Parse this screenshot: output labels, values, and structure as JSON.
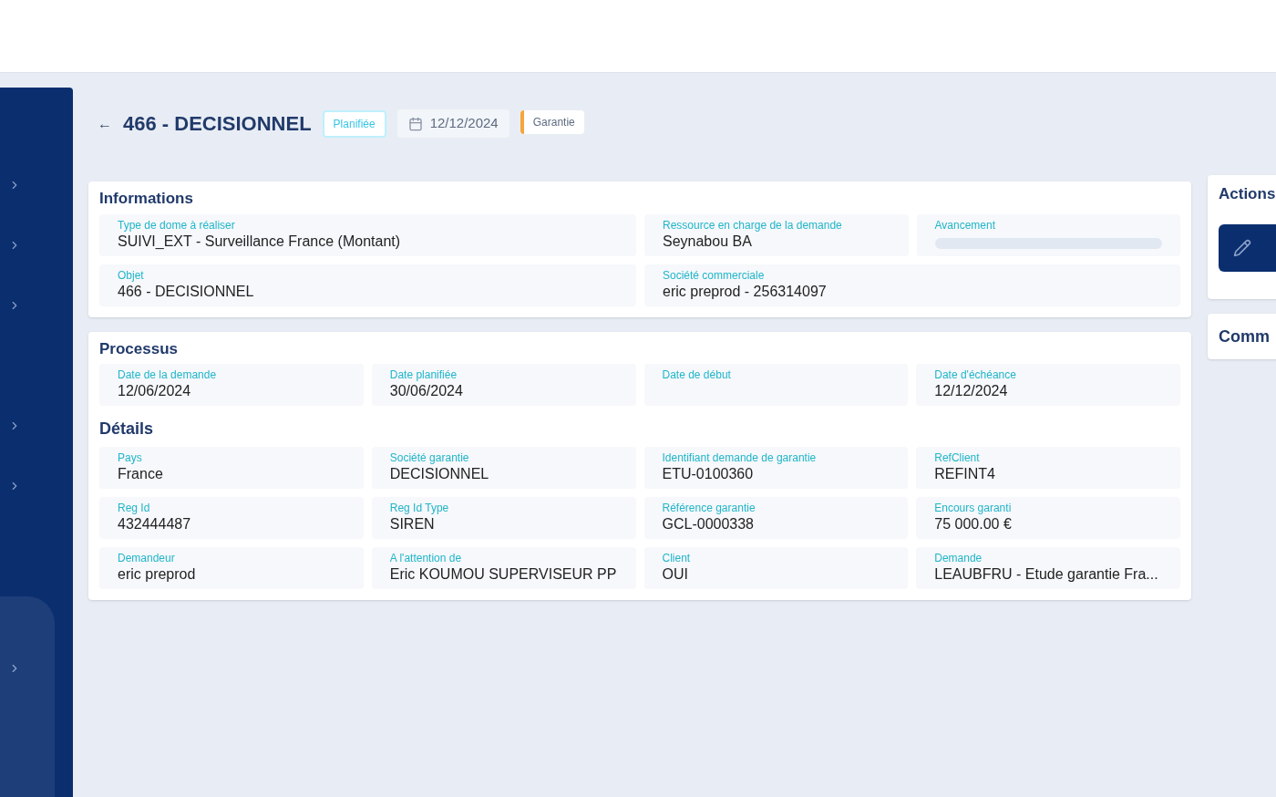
{
  "sidebar": {
    "items": [
      {
        "kind": "chevron"
      },
      {
        "kind": "chevron"
      },
      {
        "kind": "chevron"
      },
      {
        "kind": "chevron"
      },
      {
        "kind": "chevron"
      },
      {
        "kind": "chevron"
      }
    ]
  },
  "header": {
    "back": "←",
    "title": "466 - DECISIONNEL",
    "status": "Planifiée",
    "date": "12/12/2024",
    "tag": "Garantie"
  },
  "informations": {
    "title": "Informations",
    "rows": [
      [
        {
          "label": "Type de dome à réaliser",
          "value": "SUIVI_EXT - Surveillance France (Montant)",
          "kind": "text"
        },
        {
          "label": "Ressource en charge de la demande",
          "value": "Seynabou BA",
          "kind": "text"
        },
        {
          "label": "Avancement",
          "kind": "skeleton"
        }
      ],
      [
        {
          "label": "Objet",
          "value": "466 - DECISIONNEL",
          "kind": "text"
        },
        {
          "label": "Société commerciale",
          "value": "eric preprod - 256314097",
          "kind": "text"
        }
      ]
    ]
  },
  "processus": {
    "title": "Processus",
    "fields": [
      {
        "label": "Date de la demande",
        "value": "12/06/2024"
      },
      {
        "label": "Date planifiée",
        "value": "30/06/2024"
      },
      {
        "label": "Date de début"
      },
      {
        "label": "Date d'échéance",
        "value": "12/12/2024"
      }
    ]
  },
  "details": {
    "title": "Détails",
    "fields": [
      {
        "label": "Pays",
        "value": "France"
      },
      {
        "label": "Société garantie",
        "value": "DECISIONNEL"
      },
      {
        "label": "Identifiant demande de garantie",
        "value": "ETU-0100360"
      },
      {
        "label": "RefClient",
        "value": "REFINT4"
      },
      {
        "label": "Reg Id",
        "value": "432444487"
      },
      {
        "label": "Reg Id Type",
        "value": "SIREN"
      },
      {
        "label": "Référence garantie",
        "value": "GCL-0000338"
      },
      {
        "label": "Encours garanti",
        "value": "75 000.00 €"
      },
      {
        "label": "Demandeur",
        "value": "eric preprod"
      },
      {
        "label": "A l'attention de",
        "value": "Eric KOUMOU SUPERVISEUR PP"
      },
      {
        "label": "Client",
        "value": "OUI"
      },
      {
        "label": "Demande",
        "value": "LEAUBFRU - Etude garantie Fra..."
      }
    ]
  },
  "actions": {
    "title": "Actions"
  },
  "comments": {
    "title": "Comm"
  }
}
